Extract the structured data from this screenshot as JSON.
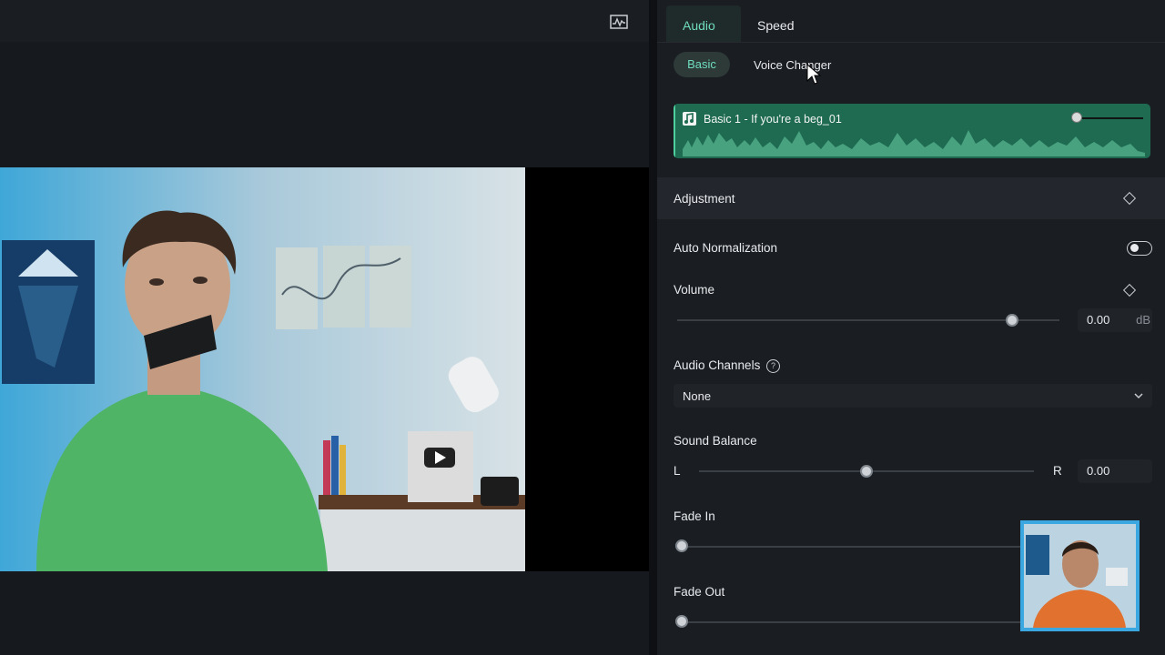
{
  "inspector": {
    "tabs": [
      {
        "label": "Audio"
      },
      {
        "label": "Speed"
      }
    ],
    "subtabs": [
      {
        "label": "Basic"
      },
      {
        "label": "Voice Changer"
      }
    ],
    "clip": {
      "title": "Basic 1 - If you're a beg_01",
      "volume_level": 0.0
    },
    "adjustment": {
      "title": "Adjustment",
      "auto_normalization": {
        "label": "Auto Normalization",
        "enabled": false
      },
      "volume": {
        "label": "Volume",
        "value": "0.00",
        "unit": "dB"
      },
      "audio_channels": {
        "label": "Audio Channels",
        "help": "?",
        "selected": "None"
      },
      "sound_balance": {
        "label": "Sound Balance",
        "left": "L",
        "right": "R",
        "value": "0.00"
      },
      "fade_in": {
        "label": "Fade In"
      },
      "fade_out": {
        "label": "Fade Out"
      }
    }
  },
  "colors": {
    "accent": "#6fdcbd",
    "clip": "#1e6b52",
    "webcam_border": "#3aa7e0"
  },
  "icons": [
    "waveform-scope-icon",
    "music-note-icon",
    "diamond-keyframe-icon",
    "help-icon",
    "chevron-down-icon"
  ]
}
